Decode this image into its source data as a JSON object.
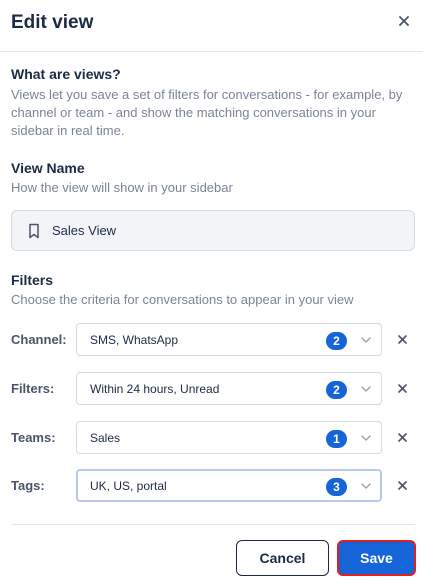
{
  "modal": {
    "title": "Edit view",
    "close_icon": "close-icon"
  },
  "about": {
    "heading": "What are views?",
    "line1": "Views let you save a set of filters for conversations - for example, by",
    "line2": "channel or team - and show the matching conversations in your",
    "line3": "sidebar in real time."
  },
  "view_name": {
    "heading": "View Name",
    "description": "How the view will show in your sidebar",
    "value": "Sales View",
    "icon": "bookmark-icon"
  },
  "filters": {
    "heading": "Filters",
    "description": "Choose the criteria for conversations to appear in your view",
    "rows": [
      {
        "label": "Channel:",
        "value": "SMS, WhatsApp",
        "count": "2"
      },
      {
        "label": "Filters:",
        "value": "Within 24 hours, Unread",
        "count": "2"
      },
      {
        "label": "Teams:",
        "value": "Sales",
        "count": "1"
      },
      {
        "label": "Tags:",
        "value": "UK, US, portal",
        "count": "3"
      }
    ]
  },
  "actions": {
    "cancel_label": "Cancel",
    "save_label": "Save"
  },
  "colors": {
    "accent": "#1565d8",
    "text_primary": "#1c2b45",
    "text_muted": "#7a8496",
    "save_outline": "#e01f1f"
  }
}
